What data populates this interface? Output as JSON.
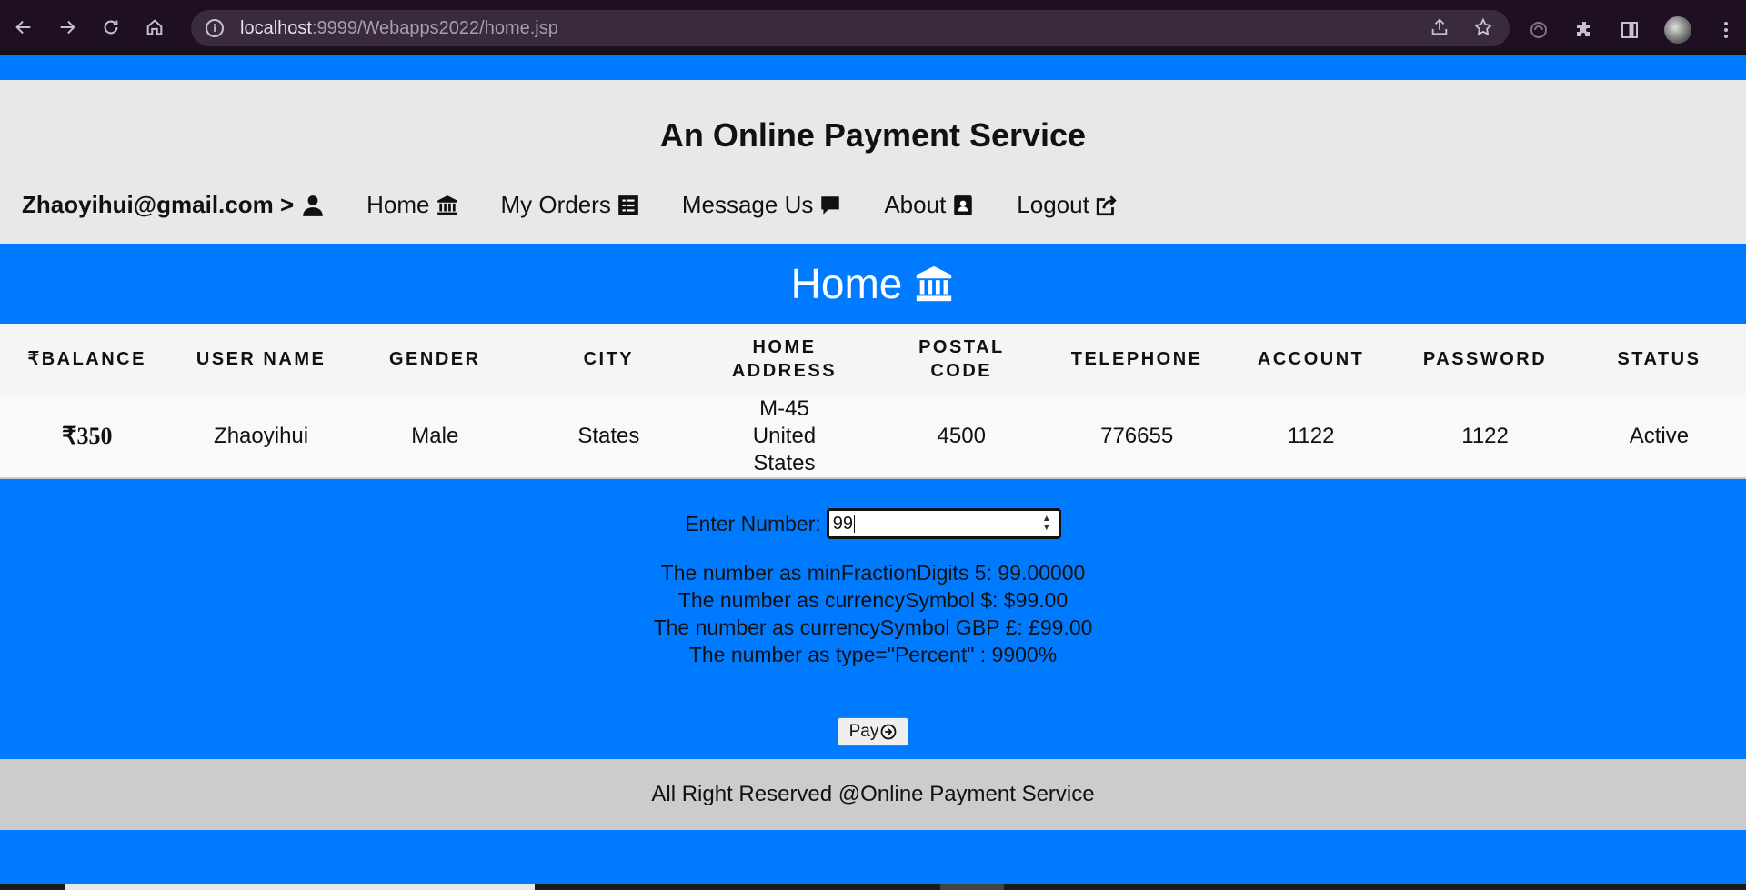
{
  "browser": {
    "url_host": "localhost",
    "url_rest": ":9999/Webapps2022/home.jsp"
  },
  "header": {
    "site_title": "An Online Payment Service",
    "user_email": "Zhaoyihui@gmail.com >",
    "nav": [
      {
        "label": "Home",
        "icon": "bank-icon"
      },
      {
        "label": "My Orders",
        "icon": "list-icon"
      },
      {
        "label": "Message Us",
        "icon": "chat-icon"
      },
      {
        "label": "About",
        "icon": "contact-book-icon"
      },
      {
        "label": "Logout",
        "icon": "share-out-icon"
      }
    ]
  },
  "main": {
    "section_title": "Home",
    "table": {
      "headers": [
        "₹BALANCE",
        "USER NAME",
        "GENDER",
        "CITY",
        "HOME ADDRESS",
        "POSTAL CODE",
        "TELEPHONE",
        "ACCOUNT",
        "PASSWORD",
        "STATUS"
      ],
      "row": [
        "₹350",
        "Zhaoyihui",
        "Male",
        "States",
        "M-45 United States",
        "4500",
        "776655",
        "1122",
        "1122",
        "Active"
      ]
    },
    "form": {
      "enter_label": "Enter Number:",
      "number_value": "99",
      "results": [
        "The number as minFractionDigits 5: 99.00000",
        "The number as currencySymbol $: $99.00",
        "The number as currencySymbol GBP £: £99.00",
        "The number as type=\"Percent\" : 9900%"
      ],
      "pay_label": "Pay"
    }
  },
  "footer": {
    "text": "All Right Reserved @Online Payment Service"
  }
}
